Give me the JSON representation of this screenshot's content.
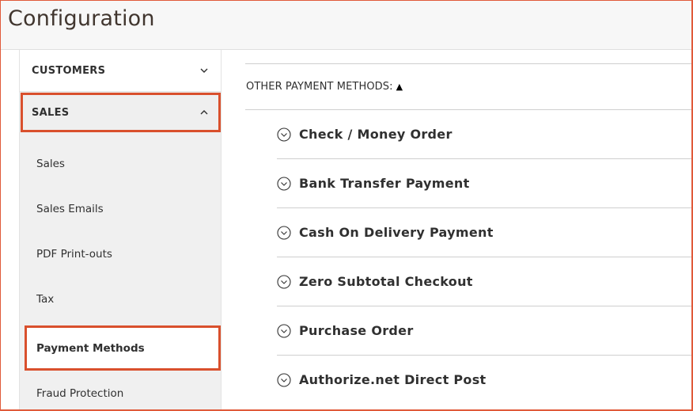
{
  "page": {
    "title": "Configuration"
  },
  "sidebar": {
    "sections": [
      {
        "label": "CUSTOMERS",
        "expanded": false
      },
      {
        "label": "SALES",
        "expanded": true
      }
    ],
    "sales_items": [
      {
        "label": "Sales"
      },
      {
        "label": "Sales Emails"
      },
      {
        "label": "PDF Print-outs"
      },
      {
        "label": "Tax"
      },
      {
        "label": "Payment Methods",
        "active": true
      },
      {
        "label": "Fraud Protection"
      }
    ]
  },
  "main": {
    "group_label": "OTHER PAYMENT METHODS:",
    "group_toggle_icon": "triangle-up-icon",
    "payment_methods": [
      {
        "label": "Check / Money Order"
      },
      {
        "label": "Bank Transfer Payment"
      },
      {
        "label": "Cash On Delivery Payment"
      },
      {
        "label": "Zero Subtotal Checkout",
        "highlighted": true
      },
      {
        "label": "Purchase Order"
      },
      {
        "label": "Authorize.net Direct Post"
      }
    ]
  },
  "colors": {
    "highlight": "#d9502d",
    "text": "#303030",
    "sidebar_bg": "#f0f0f0"
  }
}
